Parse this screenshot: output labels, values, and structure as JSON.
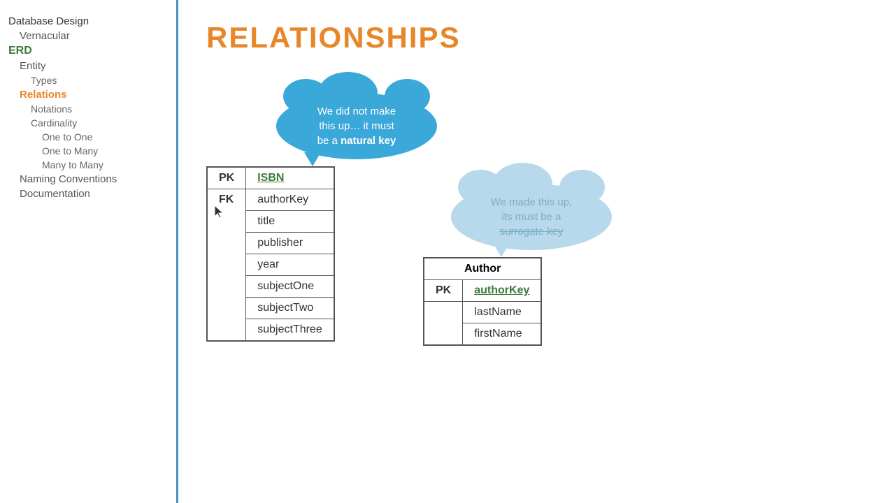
{
  "sidebar": {
    "items": [
      {
        "label": "Database Design",
        "level": "level0",
        "active": false,
        "green": false
      },
      {
        "label": "Vernacular",
        "level": "level1",
        "active": false,
        "green": false
      },
      {
        "label": "ERD",
        "level": "level0",
        "active": false,
        "green": true
      },
      {
        "label": "Entity",
        "level": "level1",
        "active": false,
        "green": false
      },
      {
        "label": "Types",
        "level": "level2",
        "active": false,
        "green": false
      },
      {
        "label": "Relations",
        "level": "level1",
        "active": true,
        "green": false
      },
      {
        "label": "Notations",
        "level": "level2",
        "active": false,
        "green": false
      },
      {
        "label": "Cardinality",
        "level": "level2",
        "active": false,
        "green": false
      },
      {
        "label": "One to One",
        "level": "level2 sub",
        "active": false,
        "green": false
      },
      {
        "label": "One to Many",
        "level": "level2 sub",
        "active": false,
        "green": false
      },
      {
        "label": "Many to Many",
        "level": "level2 sub",
        "active": false,
        "green": false
      },
      {
        "label": "Naming Conventions",
        "level": "level1",
        "active": false,
        "green": false
      },
      {
        "label": "Documentation",
        "level": "level1",
        "active": false,
        "green": false
      }
    ]
  },
  "main": {
    "title": "RELATIONSHIPS",
    "cloud_natural": "We did not make this up… it must be a natural key",
    "cloud_surrogate": "We made this up, its must be a surrogate key",
    "book_table": {
      "pk_label": "PK",
      "fk_label": "FK",
      "pk_value": "ISBN",
      "fk_value": "authorKey",
      "fields": [
        "title",
        "publisher",
        "year",
        "subjectOne",
        "subjectTwo",
        "subjectThree"
      ]
    },
    "author_table": {
      "title": "Author",
      "pk_label": "PK",
      "pk_value": "authorKey",
      "fields": [
        "lastName",
        "firstName"
      ]
    }
  }
}
